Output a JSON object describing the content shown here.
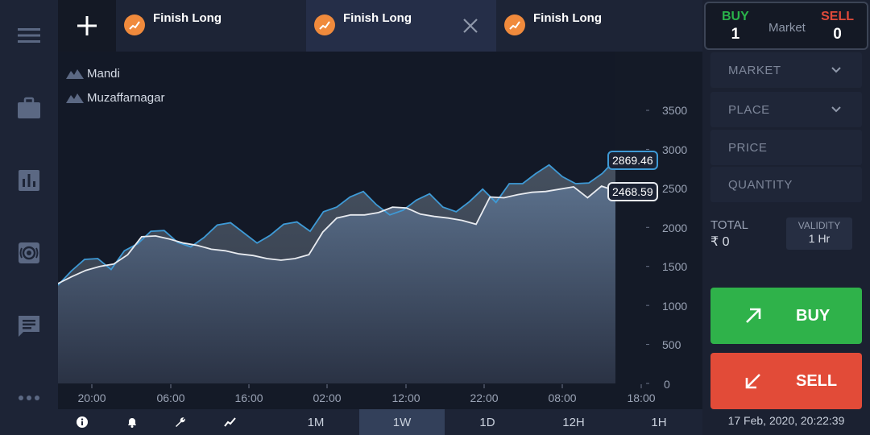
{
  "tabs": [
    {
      "label": "Finish Long"
    },
    {
      "label": "Finish Long"
    },
    {
      "label": "Finish Long"
    }
  ],
  "chart": {
    "legend": [
      "Mandi",
      "Muzaffarnagar"
    ],
    "price_tags": {
      "mandi": "2869.46",
      "muzaffarnagar": "2468.59"
    },
    "y_ticks": [
      "3500",
      "3000",
      "2500",
      "2000",
      "1500",
      "1000",
      "500",
      "0"
    ],
    "x_ticks": [
      "20:00",
      "06:00",
      "16:00",
      "02:00",
      "12:00",
      "22:00",
      "08:00",
      "18:00"
    ]
  },
  "chart_data": {
    "type": "area",
    "ylim": [
      0,
      3500
    ],
    "series": [
      {
        "name": "Mandi",
        "color": "#3e9ad6",
        "values": [
          1260,
          1440,
          1590,
          1600,
          1460,
          1700,
          1790,
          1950,
          1960,
          1810,
          1750,
          1870,
          2030,
          2060,
          1930,
          1800,
          1900,
          2040,
          2070,
          1950,
          2200,
          2260,
          2390,
          2460,
          2290,
          2160,
          2220,
          2350,
          2430,
          2260,
          2200,
          2330,
          2490,
          2320,
          2560,
          2560,
          2690,
          2800,
          2650,
          2560,
          2570,
          2690,
          2869.46
        ]
      },
      {
        "name": "Muzaffarnagar",
        "color": "#e8ebf0",
        "values": [
          1280,
          1370,
          1450,
          1500,
          1530,
          1650,
          1880,
          1890,
          1850,
          1800,
          1770,
          1720,
          1700,
          1660,
          1640,
          1600,
          1580,
          1600,
          1650,
          1940,
          2120,
          2160,
          2160,
          2190,
          2260,
          2250,
          2170,
          2140,
          2120,
          2090,
          2040,
          2390,
          2380,
          2420,
          2450,
          2460,
          2490,
          2520,
          2380,
          2530,
          2468.59
        ]
      }
    ]
  },
  "bottom": {
    "icons": [
      "info-icon",
      "bell-icon",
      "wrench-icon",
      "trend-icon"
    ],
    "timeframes": [
      "1M",
      "1W",
      "1D",
      "12H",
      "1H"
    ],
    "active_timeframe": "1W"
  },
  "order": {
    "buy_label": "BUY",
    "buy_qty": "1",
    "market_label": "Market",
    "sell_label": "SELL",
    "sell_qty": "0",
    "market_select": "MARKET",
    "place_select": "PLACE",
    "price_placeholder": "PRICE",
    "quantity_placeholder": "QUANTITY",
    "total_label": "TOTAL",
    "total_value": "₹ 0",
    "validity_label": "VALIDITY",
    "validity_value": "1 Hr",
    "buy_button": "BUY",
    "sell_button": "SELL"
  },
  "datetime": "17 Feb, 2020, 20:22:39",
  "colors": {
    "buy": "#2fb24a",
    "sell": "#e24b38",
    "accent_line": "#3e9ad6",
    "logo": "#f08a3c"
  }
}
